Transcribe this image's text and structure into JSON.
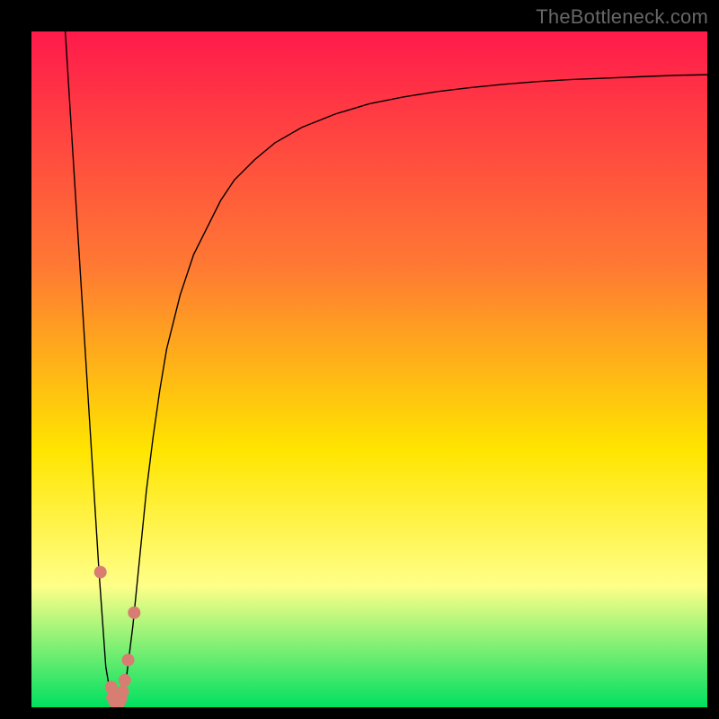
{
  "watermark": "TheBottleneck.com",
  "chart_data": {
    "type": "line",
    "title": "",
    "xlabel": "",
    "ylabel": "",
    "xlim": [
      0,
      100
    ],
    "ylim": [
      0,
      100
    ],
    "grid": false,
    "gradient": {
      "top": "#ff1a4b",
      "upper_mid": "#ff7a33",
      "mid": "#ffe500",
      "lower_mid": "#ffff88",
      "bottom": "#00e060"
    },
    "series": [
      {
        "name": "bottleneck-curve",
        "color": "#000000",
        "stroke_width": 1.4,
        "x": [
          5,
          6,
          7,
          8,
          9,
          10,
          11,
          12,
          13,
          14,
          15,
          16,
          17,
          18,
          19,
          20,
          22,
          24,
          26,
          28,
          30,
          33,
          36,
          40,
          45,
          50,
          55,
          60,
          65,
          70,
          75,
          80,
          85,
          90,
          95,
          100
        ],
        "y": [
          100,
          84,
          68,
          52,
          36,
          20,
          6,
          0,
          0,
          4,
          12,
          22,
          32,
          40,
          47,
          53,
          61,
          67,
          71,
          75,
          78,
          81,
          83.5,
          85.8,
          87.8,
          89.3,
          90.3,
          91.1,
          91.7,
          92.2,
          92.6,
          92.9,
          93.1,
          93.3,
          93.5,
          93.6
        ]
      }
    ],
    "points": {
      "name": "highlighted-measurements",
      "color": "#d87d72",
      "radius": 7,
      "x": [
        10.2,
        11.8,
        12.0,
        12.3,
        12.6,
        12.9,
        13.2,
        13.5,
        13.8,
        14.3,
        15.2
      ],
      "y": [
        20.0,
        3.0,
        1.5,
        0.8,
        0.5,
        0.6,
        1.2,
        2.3,
        4.0,
        7.0,
        14.0
      ]
    }
  }
}
